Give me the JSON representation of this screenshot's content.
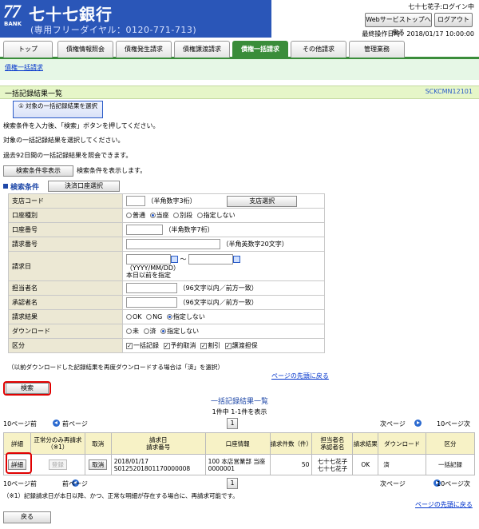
{
  "header": {
    "logo_number": "77",
    "logo_sub": "BANK",
    "bank_name": "七十七銀行",
    "toll_free": "(専用フリーダイヤル：0120-771-713)",
    "user_login": "七十七花子:ログイン中",
    "web_top_button": "Webサービストップへ戻る",
    "logout_button": "ログアウト",
    "last_operation": "最終操作日時：2018/01/17 10:00:00"
  },
  "tabs": [
    {
      "label": "トップ",
      "active": false
    },
    {
      "label": "債権情報照会",
      "active": false
    },
    {
      "label": "債権発生請求",
      "active": false
    },
    {
      "label": "債権譲渡請求",
      "active": false
    },
    {
      "label": "債権一括請求",
      "active": true
    },
    {
      "label": "その他請求",
      "active": false
    },
    {
      "label": "管理業務",
      "active": false
    }
  ],
  "subnav": {
    "link": "債権一括請求"
  },
  "page": {
    "title": "一括記録結果一覧",
    "screen_id": "SCKCMN12101",
    "select_button": "① 対象の一括記録結果を選択",
    "info_lines": [
      "検索条件を入力後、「検索」ボタンを押してください。",
      "対象の一括記録結果を選択してください。",
      "過去92日間の一括記録結果を照会できます。"
    ],
    "toggle_button": "検索条件非表示",
    "toggle_note": "検索条件を表示します。",
    "conditions_heading": "検索条件",
    "account_select_button": "決済口座選択"
  },
  "form": {
    "branch_code": {
      "label": "支店コード",
      "note": "（半角数字3桁）",
      "button": "支店選択"
    },
    "account_type": {
      "label": "口座種別",
      "options": [
        "普通",
        "当座",
        "別段",
        "指定しない"
      ],
      "selected": "当座"
    },
    "account_number": {
      "label": "口座番号",
      "note": "（半角数字7桁）"
    },
    "request_number": {
      "label": "請求番号",
      "note": "（半角英数字20文字）"
    },
    "request_date": {
      "label": "請求日",
      "separator": "～",
      "format": "（YYYY/MM/DD）",
      "note": "本日以前を指定"
    },
    "person_in_charge": {
      "label": "担当者名",
      "note": "（96文字以内／前方一致）"
    },
    "approver": {
      "label": "承認者名",
      "note": "（96文字以内／前方一致）"
    },
    "result": {
      "label": "請求結果",
      "options": [
        "OK",
        "NG",
        "指定しない"
      ],
      "selected": "指定しない"
    },
    "download": {
      "label": "ダウンロード",
      "options": [
        "未",
        "済",
        "指定しない"
      ],
      "selected": "指定しない"
    },
    "category": {
      "label": "区分",
      "options": [
        "一括記録",
        "予約取消",
        "割引",
        "譲渡担保"
      ],
      "checked": [
        true,
        true,
        true,
        true
      ]
    },
    "footnote": "（以前ダウンロードした記録結果を再度ダウンロードする場合は「済」を選択）",
    "page_top_link": "ページの先頭に戻る"
  },
  "search_button": "検索",
  "results": {
    "title": "一括記録結果一覧",
    "count": "1件中 1-1件を表示",
    "prev10": "10ページ前",
    "prev": "前ページ",
    "next": "次ページ",
    "next10": "10ページ次",
    "page": "1",
    "headers": [
      "詳細",
      "正常分のみ再請求（※1）",
      "取消",
      "請求日\n請求番号",
      "口座情報",
      "請求件数（件）",
      "担当者名\n承認者名",
      "請求結果",
      "ダウンロード",
      "区分"
    ],
    "rows": [
      {
        "detail": "詳細",
        "resubmit": "登録",
        "cancel": "取消",
        "date": "2018/01/17",
        "request_no": "S0125201801170000008",
        "account_line1": "100 本店営業部 当座",
        "account_line2": "0000001",
        "count": "50",
        "person": "七十七花子",
        "approver": "七十七花子",
        "result": "OK",
        "download": "済",
        "category": "一括記録"
      }
    ],
    "note": "（※1）記録請求日が本日以降、かつ、正常な明細が存在する場合に、再請求可能です。",
    "page_top_link": "ページの先頭に戻る"
  },
  "back_button": "戻る"
}
